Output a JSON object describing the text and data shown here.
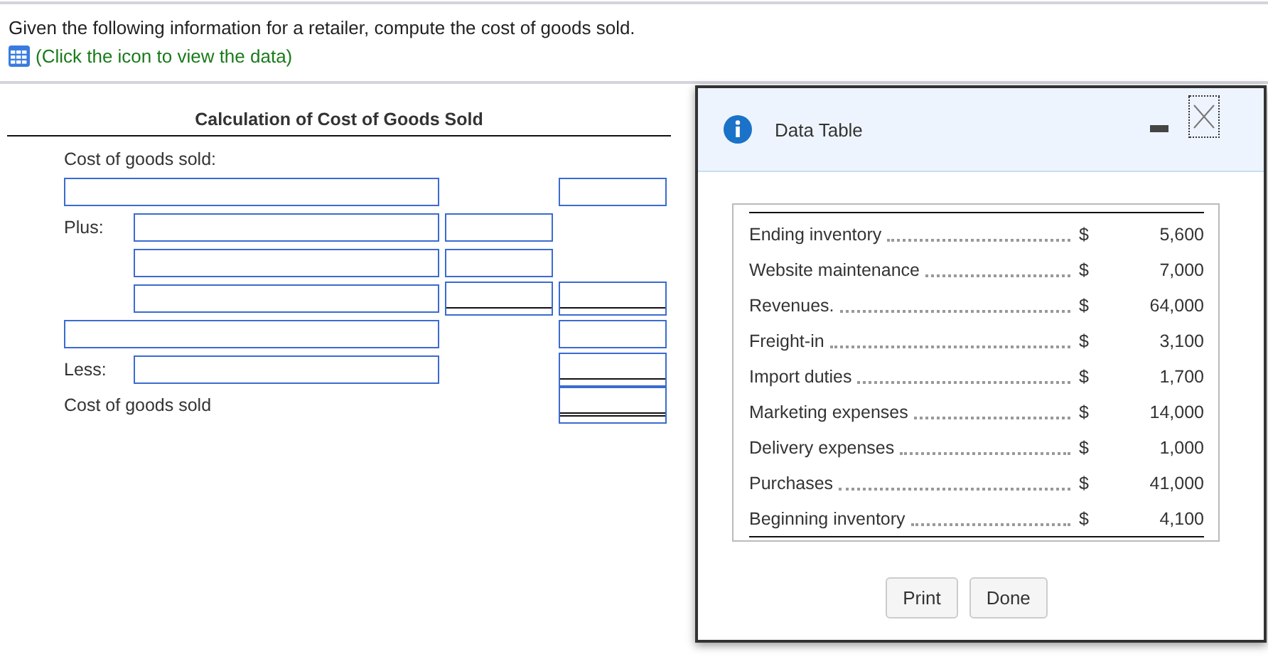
{
  "question": "Given the following information for a retailer, compute the cost of goods sold.",
  "data_link": "(Click the icon to view the data)",
  "worksheet": {
    "title": "Calculation of Cost of Goods Sold",
    "rows": [
      {
        "label": "Cost of goods sold:"
      },
      {
        "fields": [
          {
            "kind": "wide"
          },
          {
            "kind": "empty"
          },
          {
            "kind": "plain"
          }
        ]
      },
      {
        "label": "Plus:",
        "fields": [
          {
            "kind": "indent"
          },
          {
            "kind": "plain"
          }
        ]
      },
      {
        "fields": [
          {
            "kind": "indent"
          },
          {
            "kind": "plain"
          }
        ]
      },
      {
        "fields": [
          {
            "kind": "indent"
          },
          {
            "kind": "underlined"
          },
          {
            "kind": "underlined"
          }
        ]
      },
      {
        "fields": [
          {
            "kind": "wide"
          },
          {
            "kind": "empty"
          },
          {
            "kind": "plain"
          }
        ]
      },
      {
        "label": "Less:",
        "fields": [
          {
            "kind": "indent"
          },
          {
            "kind": "empty"
          },
          {
            "kind": "underlined"
          }
        ]
      },
      {
        "label": "Cost of goods sold",
        "fields": [
          {
            "kind": "empty"
          },
          {
            "kind": "empty"
          },
          {
            "kind": "doubled"
          }
        ]
      }
    ]
  },
  "dialog": {
    "title": "Data Table",
    "items": [
      {
        "name": "Ending inventory",
        "currency": "$",
        "amount": "5,600"
      },
      {
        "name": "Website maintenance",
        "currency": "$",
        "amount": "7,000"
      },
      {
        "name": "Revenues.",
        "currency": "$",
        "amount": "64,000"
      },
      {
        "name": "Freight-in",
        "currency": "$",
        "amount": "3,100"
      },
      {
        "name": "Import duties",
        "currency": "$",
        "amount": "1,700"
      },
      {
        "name": "Marketing expenses",
        "currency": "$",
        "amount": "14,000"
      },
      {
        "name": "Delivery expenses",
        "currency": "$",
        "amount": "1,000"
      },
      {
        "name": "Purchases",
        "currency": "$",
        "amount": "41,000"
      },
      {
        "name": "Beginning inventory",
        "currency": "$",
        "amount": "4,100"
      }
    ],
    "buttons": [
      "Print",
      "Done"
    ]
  }
}
